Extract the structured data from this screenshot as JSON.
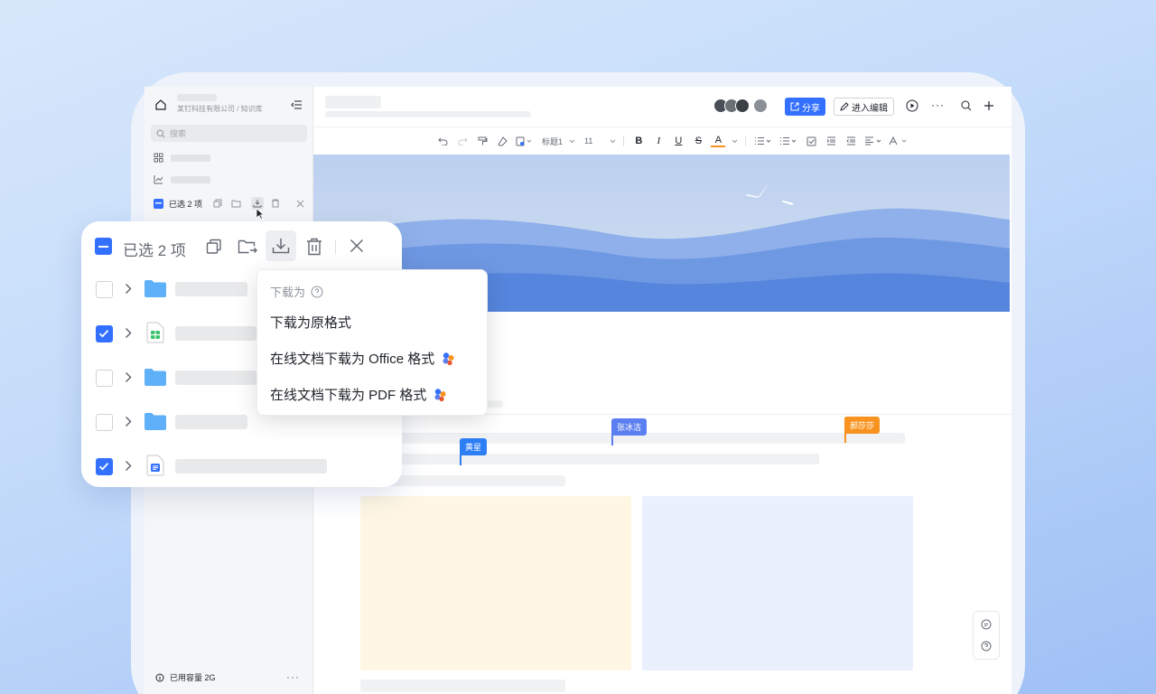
{
  "sidebar": {
    "breadcrumb": "某钉科技有限公司 / 知识库",
    "search_placeholder": "搜索",
    "selection_label": "已选 2 项",
    "storage_label": "已用容量 2G"
  },
  "header": {
    "share_label": "分享",
    "edit_label": "进入编辑"
  },
  "toolbar": {
    "heading_style": "标题1",
    "font_size": "11"
  },
  "collaborators": {
    "tag1": "张冰洁",
    "tag2": "郝莎莎",
    "tag3": "黄星"
  },
  "panel": {
    "selection_label": "已选 2 项",
    "rows": [
      {
        "type": "folder",
        "checked": false
      },
      {
        "type": "sheet",
        "checked": true
      },
      {
        "type": "folder",
        "checked": false
      },
      {
        "type": "folder",
        "checked": false
      },
      {
        "type": "doc",
        "checked": true
      }
    ]
  },
  "download_menu": {
    "title": "下载为",
    "items": [
      {
        "label": "下载为原格式"
      },
      {
        "label": "在线文档下载为 Office 格式"
      },
      {
        "label": "在线文档下载为 PDF 格式"
      }
    ]
  },
  "colors": {
    "accent": "#3370ff",
    "tag1": "#5b7ff0",
    "tag2": "#f7931e",
    "tag3": "#2e7ff5"
  }
}
